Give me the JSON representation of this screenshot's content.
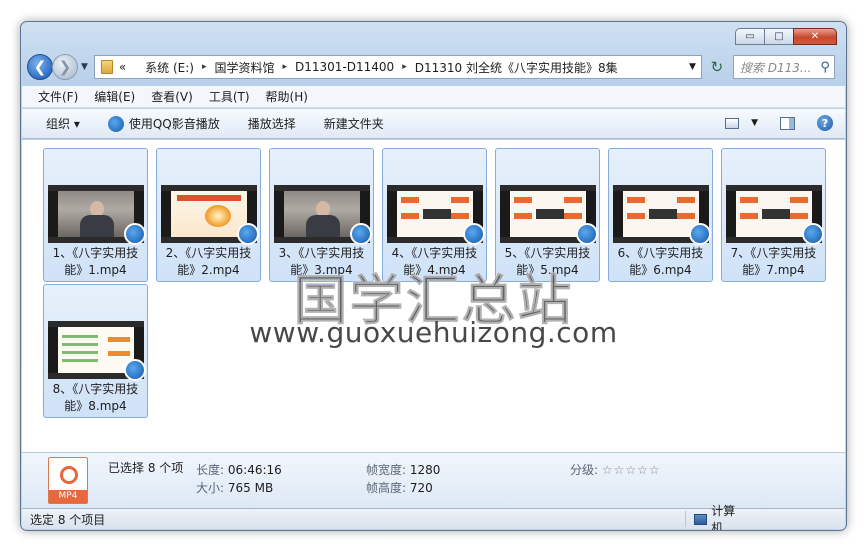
{
  "window": {
    "controls": {
      "minimize": "▭",
      "maximize": "□",
      "close": "✕"
    }
  },
  "address": {
    "prefix": "«",
    "crumbs": [
      "系统 (E:)",
      "国学资料馆",
      "D11301-D11400",
      "D11310 刘全统《八字实用技能》8集"
    ],
    "separator": "▸"
  },
  "search": {
    "placeholder": "搜索 D113..."
  },
  "menu": [
    "文件(F)",
    "编辑(E)",
    "查看(V)",
    "工具(T)",
    "帮助(H)"
  ],
  "toolbar": {
    "organize": "组织 ▾",
    "play_qq": "使用QQ影音播放",
    "play_selection": "播放选择",
    "new_folder": "新建文件夹"
  },
  "files": [
    {
      "line1": "1、《八字实用技",
      "line2": "能》1.mp4",
      "thumb": "person"
    },
    {
      "line1": "2、《八字实用技",
      "line2": "能》2.mp4",
      "thumb": "slide1"
    },
    {
      "line1": "3、《八字实用技",
      "line2": "能》3.mp4",
      "thumb": "person"
    },
    {
      "line1": "4、《八字实用技",
      "line2": "能》4.mp4",
      "thumb": "slide2"
    },
    {
      "line1": "5、《八字实用技",
      "line2": "能》5.mp4",
      "thumb": "slide2"
    },
    {
      "line1": "6、《八字实用技",
      "line2": "能》6.mp4",
      "thumb": "slide2"
    },
    {
      "line1": "7、《八字实用技",
      "line2": "能》7.mp4",
      "thumb": "slide2"
    },
    {
      "line1": "8、《八字实用技",
      "line2": "能》8.mp4",
      "thumb": "slide3"
    }
  ],
  "watermark": {
    "chinese": "国学汇总站",
    "url": "www.guoxuehuizong.com"
  },
  "details": {
    "icon_tag": "MP4",
    "selected": "已选择 8 个项",
    "duration_label": "长度:",
    "duration": "06:46:16",
    "size_label": "大小:",
    "size": "765 MB",
    "width_label": "帧宽度:",
    "width": "1280",
    "height_label": "帧高度:",
    "height": "720",
    "rating_label": "分级:",
    "rating": "☆☆☆☆☆"
  },
  "status": {
    "left": "选定 8 个项目",
    "right": "计算机"
  }
}
